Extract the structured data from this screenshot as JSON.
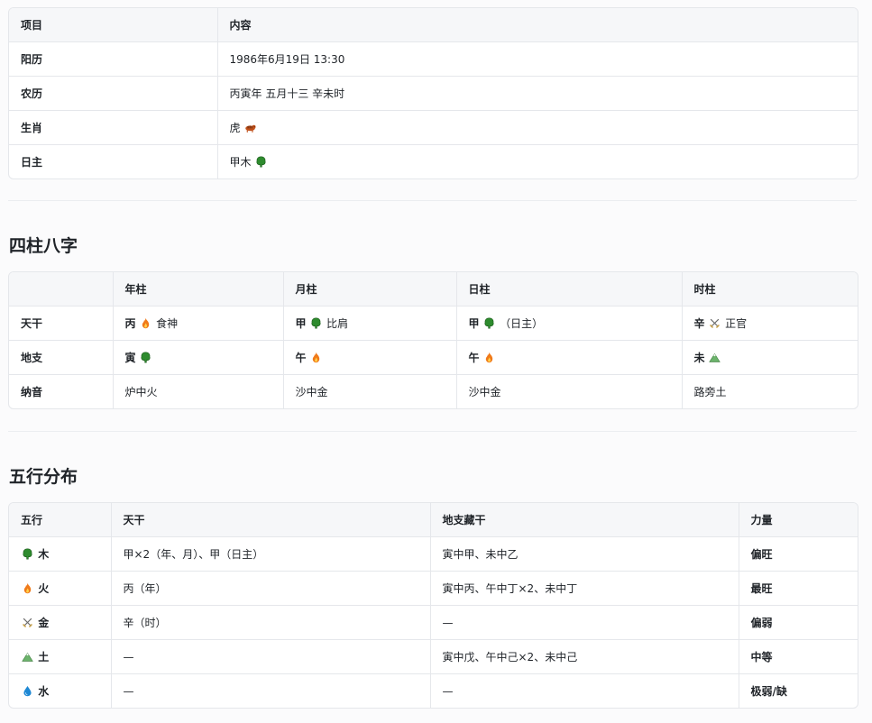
{
  "basic": {
    "headers": [
      "项目",
      "内容"
    ],
    "rows": [
      {
        "label": "阳历",
        "value": "1986年6月19日 13:30"
      },
      {
        "label": "农历",
        "value": "丙寅年 五月十三 辛未时"
      },
      {
        "label": "生肖",
        "value": "虎",
        "icon": "tiger-icon"
      },
      {
        "label": "日主",
        "value": "甲木",
        "icon": "tree-icon"
      }
    ]
  },
  "pillars": {
    "title": "四柱八字",
    "headers": [
      "",
      "年柱",
      "月柱",
      "日柱",
      "时柱"
    ],
    "rows": [
      {
        "label": "天干",
        "cells": [
          {
            "char": "丙",
            "icon": "fire-icon",
            "note": "食神"
          },
          {
            "char": "甲",
            "icon": "tree-icon",
            "note": "比肩"
          },
          {
            "char": "甲",
            "icon": "tree-icon",
            "note": "（日主）"
          },
          {
            "char": "辛",
            "icon": "swords-icon",
            "note": "正官"
          }
        ]
      },
      {
        "label": "地支",
        "cells": [
          {
            "char": "寅",
            "icon": "tree-icon"
          },
          {
            "char": "午",
            "icon": "fire-icon"
          },
          {
            "char": "午",
            "icon": "fire-icon"
          },
          {
            "char": "未",
            "icon": "mountain-icon"
          }
        ]
      },
      {
        "label": "纳音",
        "cells": [
          {
            "text": "炉中火"
          },
          {
            "text": "沙中金"
          },
          {
            "text": "沙中金"
          },
          {
            "text": "路旁土"
          }
        ]
      }
    ]
  },
  "elements": {
    "title": "五行分布",
    "headers": [
      "五行",
      "天干",
      "地支藏干",
      "力量"
    ],
    "rows": [
      {
        "element": "木",
        "icon": "tree-icon",
        "stems": "甲×2（年、月）、甲（日主）",
        "hidden": "寅中甲、未中乙",
        "strength": "偏旺"
      },
      {
        "element": "火",
        "icon": "fire-icon",
        "stems": "丙（年）",
        "hidden": "寅中丙、午中丁×2、未中丁",
        "strength": "最旺"
      },
      {
        "element": "金",
        "icon": "swords-icon",
        "stems": "辛（时）",
        "hidden": "—",
        "strength": "偏弱"
      },
      {
        "element": "土",
        "icon": "mountain-icon",
        "stems": "—",
        "hidden": "寅中戊、午中己×2、未中己",
        "strength": "中等"
      },
      {
        "element": "水",
        "icon": "droplet-icon",
        "stems": "—",
        "hidden": "—",
        "strength": "极弱/缺"
      }
    ]
  },
  "colors": {
    "tree": "#2e8b2e",
    "fire": "#f07a1a",
    "metal": "#c8a24a",
    "earth": "#6bb36b",
    "water": "#1e88d4",
    "tiger": "#c0501a"
  }
}
